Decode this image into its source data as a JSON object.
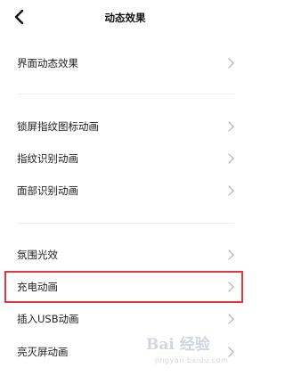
{
  "header": {
    "back_icon": "chevron-left-icon",
    "title": "动态效果"
  },
  "groups": [
    {
      "items": [
        {
          "label": "界面动态效果"
        }
      ]
    },
    {
      "items": [
        {
          "label": "锁屏指纹图标动画"
        },
        {
          "label": "指纹识别动画"
        },
        {
          "label": "面部识别动画"
        }
      ]
    },
    {
      "items": [
        {
          "label": "氛围光效"
        },
        {
          "label": "充电动画"
        },
        {
          "label": "插入USB动画"
        },
        {
          "label": "亮灭屏动画"
        }
      ]
    }
  ],
  "item_icon": "chevron-right-icon",
  "highlight": {
    "target": "充电动画",
    "color": "#e0383e"
  },
  "watermark": {
    "text": "Bai 经验",
    "subtext": "jingyan.baidu.com"
  }
}
